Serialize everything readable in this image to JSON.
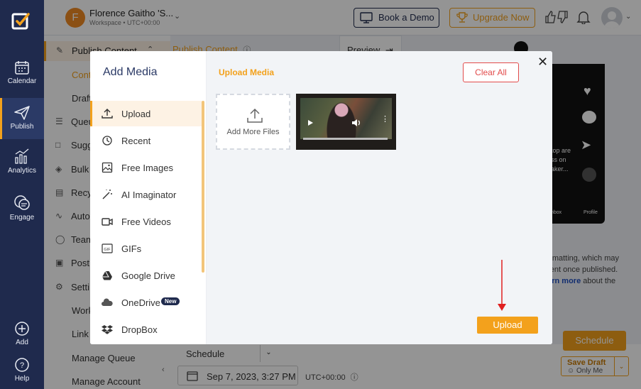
{
  "rail": {
    "items": [
      {
        "label": "Calendar",
        "icon": "calendar-icon"
      },
      {
        "label": "Publish",
        "icon": "paper-plane-icon",
        "active": true
      },
      {
        "label": "Analytics",
        "icon": "analytics-icon"
      },
      {
        "label": "Engage",
        "icon": "chat-bubbles-icon"
      }
    ],
    "add_label": "Add",
    "help_label": "Help"
  },
  "topbar": {
    "workspace_initial": "F",
    "workspace_name": "Florence Gaitho 'S...",
    "workspace_sub": "Workspace • UTC+00:00",
    "book_demo": "Book a Demo",
    "upgrade": "Upgrade Now"
  },
  "subnav": {
    "header": "Publish Content",
    "items": [
      "Cont",
      "Draft",
      "Queu",
      "Sugg",
      "Bulk",
      "Recy",
      "Auto",
      "Team",
      "Post",
      "Setti",
      "Work",
      "Link",
      "Manage Queue",
      "Manage Account"
    ]
  },
  "main": {
    "heading": "Publish Content",
    "preview_tab": "Preview",
    "phone_caption": [
      "top are",
      "ss on",
      "aker..."
    ],
    "phone_inbox": "nbox",
    "phone_profile": "Profile",
    "note_lines": [
      "formatting, which may",
      "erent once published."
    ],
    "note_link": "earn more",
    "note_tail": " about the",
    "schedule_label": "Schedule",
    "date": "Sep 7, 2023, 3:27 PM",
    "timezone": "UTC+00:00",
    "schedule_button": "Schedule",
    "save_draft": "Save Draft",
    "only_me": "Only Me"
  },
  "modal": {
    "title": "Add Media",
    "upload_heading": "Upload Media",
    "clear_all": "Clear All",
    "add_more_files": "Add More Files",
    "upload_button": "Upload",
    "sources": [
      {
        "label": "Upload",
        "icon": "upload-icon",
        "active": true
      },
      {
        "label": "Recent",
        "icon": "history-icon"
      },
      {
        "label": "Free Images",
        "icon": "image-icon"
      },
      {
        "label": "AI Imaginator",
        "icon": "magic-wand-icon"
      },
      {
        "label": "Free Videos",
        "icon": "video-icon"
      },
      {
        "label": "GIFs",
        "icon": "gif-icon"
      },
      {
        "label": "Google Drive",
        "icon": "google-drive-icon"
      },
      {
        "label": "OneDrive",
        "icon": "cloud-icon",
        "badge": "New"
      },
      {
        "label": "DropBox",
        "icon": "dropbox-icon"
      }
    ]
  },
  "colors": {
    "accent": "#f3a11c",
    "rail": "#1f2a4d",
    "danger": "#e24b4b"
  }
}
